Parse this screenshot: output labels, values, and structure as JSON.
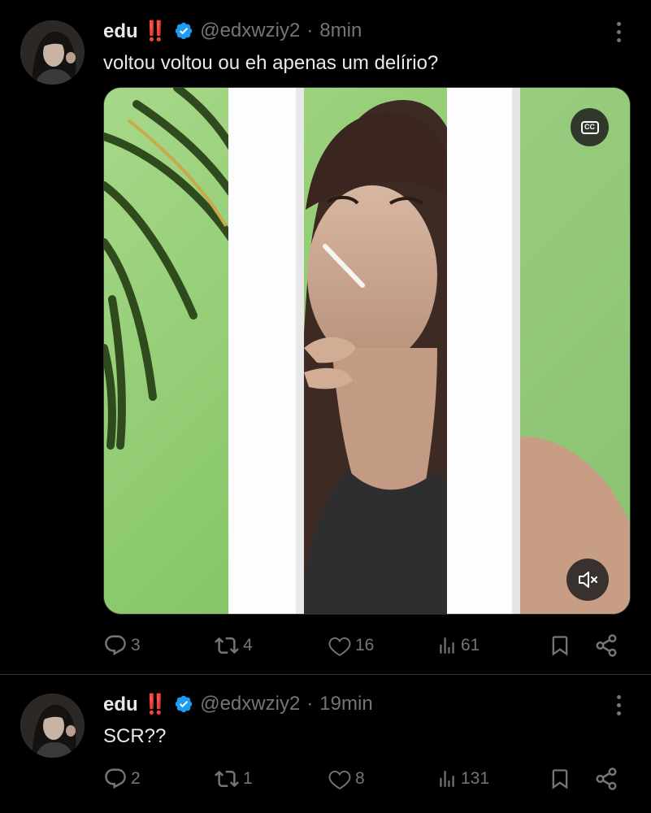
{
  "colors": {
    "background": "#000000",
    "text_primary": "#e7e9ea",
    "text_secondary": "#71767b",
    "verified_badge": "#1d9bf0",
    "divider": "#2f3336"
  },
  "tweets": [
    {
      "name": "edu ‼️",
      "handle": "@edxwziy2",
      "separator": "·",
      "time": "8min",
      "text": "voltou voltou ou eh apenas um delírio?",
      "media": {
        "type": "video",
        "cc_label": "CC",
        "cc_icon": "closed-captions-icon",
        "mute_icon": "volume-muted-icon"
      },
      "stats": {
        "replies": "3",
        "retweets": "4",
        "likes": "16",
        "views": "61"
      }
    },
    {
      "name": "edu ‼️",
      "handle": "@edxwziy2",
      "separator": "·",
      "time": "19min",
      "text": "SCR??",
      "stats": {
        "replies": "2",
        "retweets": "1",
        "likes": "8",
        "views": "131"
      }
    }
  ],
  "icons": {
    "reply": "reply-icon",
    "retweet": "retweet-icon",
    "like": "heart-icon",
    "views": "views-chart-icon",
    "bookmark": "bookmark-icon",
    "share": "share-icon",
    "more": "more-options-icon",
    "verified": "verified-badge-icon"
  }
}
